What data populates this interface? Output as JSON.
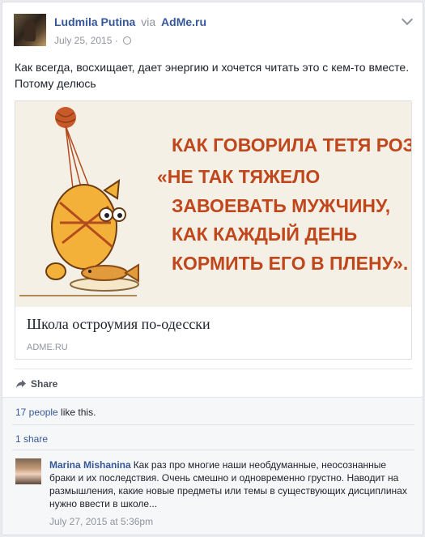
{
  "post": {
    "author": "Ludmila Putina",
    "via": "via",
    "page": "AdMe.ru",
    "date": "July 25, 2015",
    "text": "Как всегда, восхищает, дает энергию и хочется читать это с кем-то вместе. Потому делюсь"
  },
  "attachment": {
    "image_lines": [
      "КАК ГОВОРИЛА ТЕТЯ РОЗА:",
      "«НЕ ТАК ТЯЖЕЛО",
      "ЗАВОЕВАТЬ МУЖЧИНУ,",
      "КАК КАЖДЫЙ ДЕНЬ",
      "КОРМИТЬ ЕГО В ПЛЕНУ»."
    ],
    "title": "Школа остроумия по-одесски",
    "domain": "ADME.RU"
  },
  "actions": {
    "share": "Share"
  },
  "feedback": {
    "likes_count": "17 people",
    "likes_suffix": " like this.",
    "shares": "1 share"
  },
  "comment": {
    "author": "Marina Mishanina",
    "text": "Как раз про многие наши необдуманные, неосознанные браки и их последствия. Очень смешно и одновременно грустно. Наводит на размышления, какие новые предметы или темы в существующих дисциплинах нужно ввести в школе...",
    "time": "July 27, 2015 at 5:36pm"
  },
  "colors": {
    "link": "#365899",
    "quote_text": "#c0461c",
    "meta": "#90949c"
  }
}
